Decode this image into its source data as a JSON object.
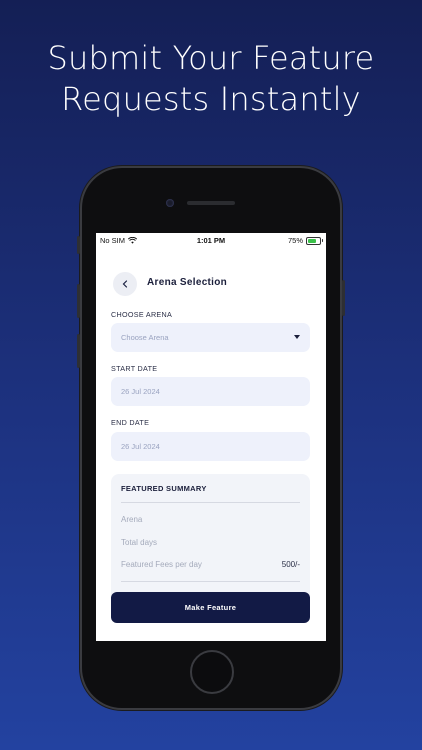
{
  "headline": {
    "line1": "Submit Your Feature",
    "line2": "Requests Instantly"
  },
  "status_bar": {
    "carrier": "No SIM",
    "time": "1:01 PM",
    "battery": "75%",
    "battery_level": 0.75
  },
  "screen": {
    "title": "Arena Selection",
    "back_icon": "chevron-left-icon",
    "choose_arena": {
      "label": "CHOOSE ARENA",
      "placeholder": "Choose Arena"
    },
    "start_date": {
      "label": "START DATE",
      "value": "26 Jul 2024"
    },
    "end_date": {
      "label": "END DATE",
      "value": "26 Jul 2024"
    },
    "summary": {
      "title": "FEATURED SUMMARY",
      "rows": [
        {
          "label": "Arena",
          "value": ""
        },
        {
          "label": "Total days",
          "value": ""
        },
        {
          "label": "Featured Fees per day",
          "value": "500/-"
        }
      ]
    },
    "make_feature_button": "Make Feature"
  },
  "colors": {
    "accent": "#121a45",
    "field_bg": "#eef1fb",
    "background_top": "#141f55",
    "background_bottom": "#2342a0"
  }
}
